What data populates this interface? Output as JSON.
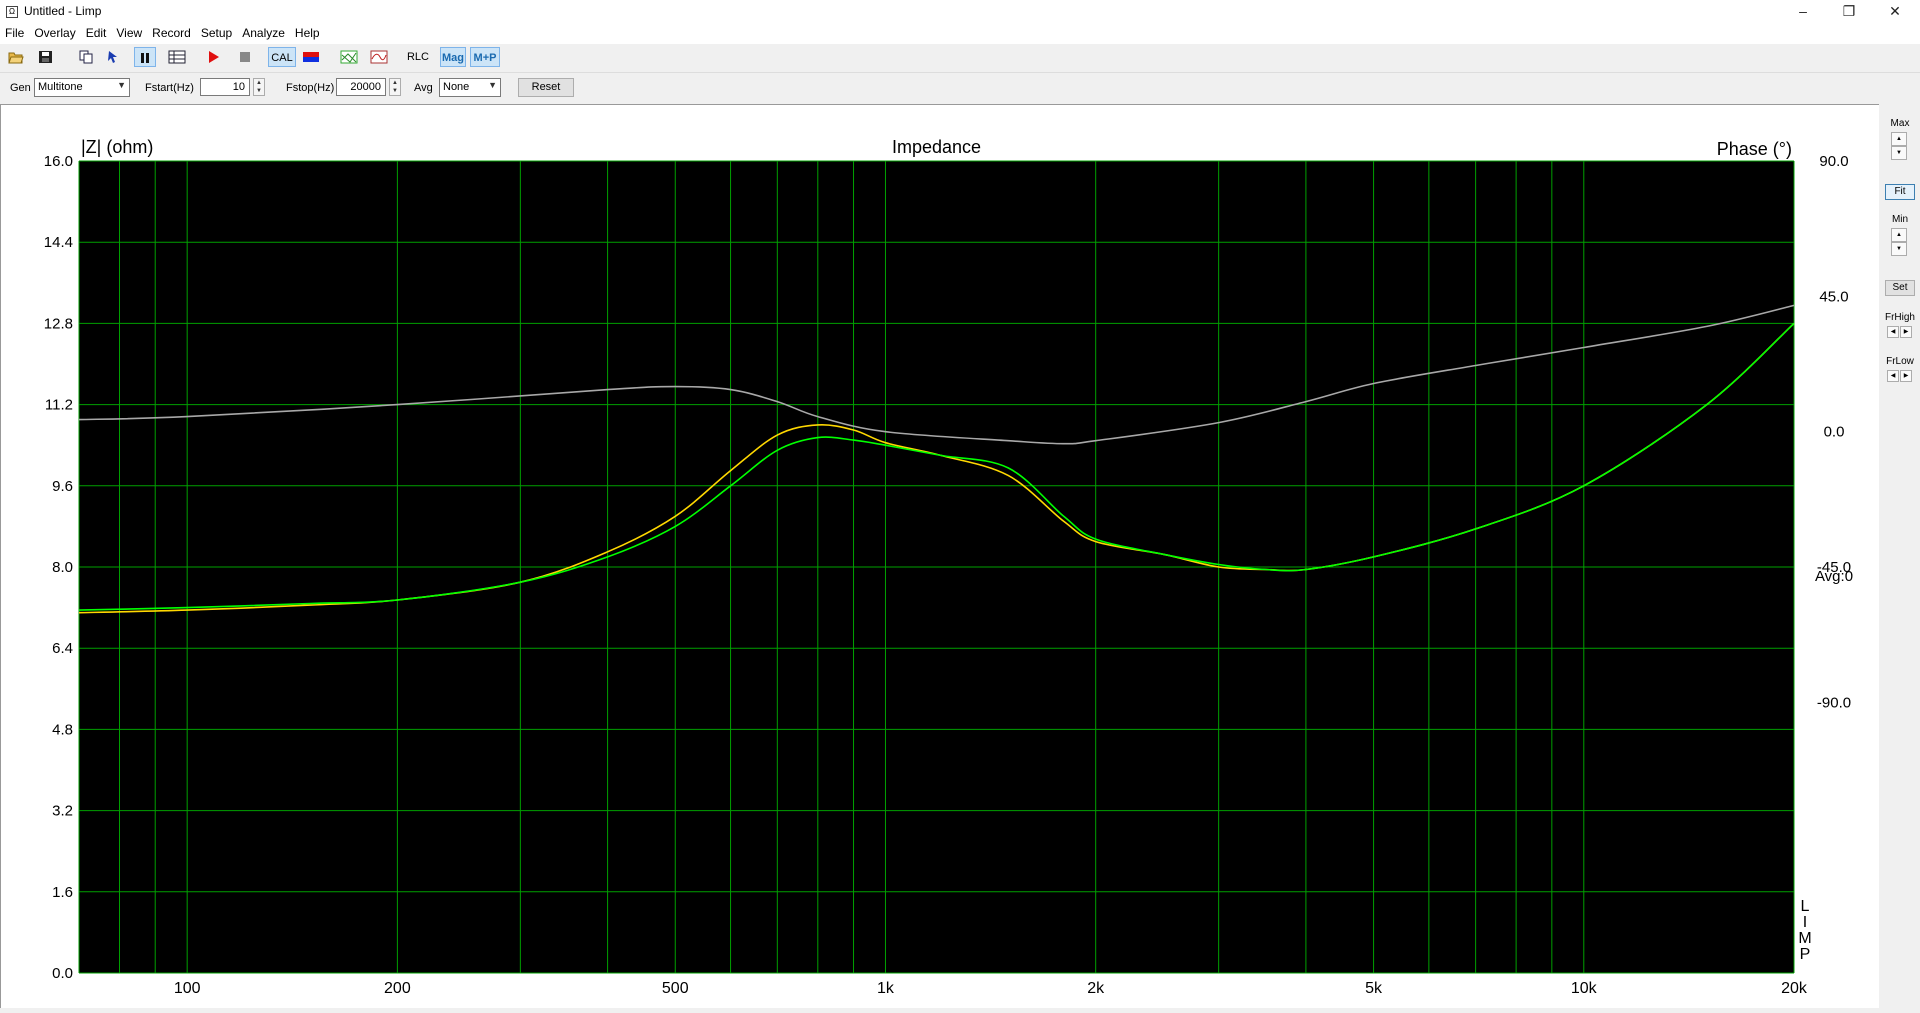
{
  "window": {
    "title": "Untitled - Limp",
    "minimize": "–",
    "restore": "❐",
    "close": "✕"
  },
  "menu": [
    "File",
    "Overlay",
    "Edit",
    "View",
    "Record",
    "Setup",
    "Analyze",
    "Help"
  ],
  "toolbar": {
    "cal": "CAL",
    "rlc": "RLC",
    "mag": "Mag",
    "mp": "M+P"
  },
  "params": {
    "gen_label": "Gen",
    "gen_value": "Multitone",
    "fstart_label": "Fstart(Hz)",
    "fstart_value": "10",
    "fstop_label": "Fstop(Hz)",
    "fstop_value": "20000",
    "avg_label": "Avg",
    "avg_value": "None",
    "reset": "Reset"
  },
  "side": {
    "max": "Max",
    "fit": "Fit",
    "min": "Min",
    "set": "Set",
    "frhigh": "FrHigh",
    "frlow": "FrLow"
  },
  "colors": {
    "plot_bg": "#000000",
    "grid": "#00a000",
    "curve_measured": "#00ff00",
    "curve_overlay": "#ffd800",
    "phase": "#a8a8a8"
  },
  "chart_data": {
    "type": "line",
    "title": "Impedance",
    "ylabel": "|Z| (ohm)",
    "y2label": "Phase (°)",
    "x_scale": "log",
    "xlim": [
      70,
      20000
    ],
    "ylim": [
      0,
      16
    ],
    "y2lim": [
      -180,
      90
    ],
    "x_ticks": [
      {
        "v": 100,
        "label": "100"
      },
      {
        "v": 200,
        "label": "200"
      },
      {
        "v": 500,
        "label": "500"
      },
      {
        "v": 1000,
        "label": "1k"
      },
      {
        "v": 2000,
        "label": "2k"
      },
      {
        "v": 5000,
        "label": "5k"
      },
      {
        "v": 10000,
        "label": "10k"
      },
      {
        "v": 20000,
        "label": "20k"
      }
    ],
    "y_ticks": [
      "0.0",
      "1.6",
      "3.2",
      "4.8",
      "6.4",
      "8.0",
      "9.6",
      "11.2",
      "12.8",
      "14.4",
      "16.0"
    ],
    "y2_ticks": [
      {
        "v": 90,
        "label": "90.0"
      },
      {
        "v": 45,
        "label": "45.0"
      },
      {
        "v": 0,
        "label": "0.0"
      },
      {
        "v": -45,
        "label": "-45.0"
      },
      {
        "v": -90,
        "label": "-90.0"
      }
    ],
    "avg_label": "Avg:0",
    "vertical_label": [
      "L",
      "I",
      "M",
      "P"
    ],
    "series": [
      {
        "color": "#a8a8a8",
        "axis": "phase",
        "x": [
          70,
          100,
          200,
          400,
          500,
          600,
          700,
          800,
          1000,
          1500,
          1800,
          2000,
          3000,
          4000,
          5000,
          7000,
          10000,
          15000,
          20000
        ],
        "y": [
          4,
          5,
          9,
          14,
          15,
          14,
          10,
          5,
          0,
          -3,
          -4,
          -3,
          3,
          10,
          16,
          22,
          28,
          35,
          42
        ]
      },
      {
        "color": "#ffd800",
        "axis": "impedance",
        "x": [
          70,
          100,
          150,
          200,
          300,
          400,
          500,
          600,
          700,
          800,
          900,
          1000,
          1200,
          1500,
          1800,
          2000,
          2500,
          3000,
          3500,
          4000,
          5000,
          7000,
          10000,
          15000,
          20000
        ],
        "y": [
          7.1,
          7.15,
          7.25,
          7.35,
          7.7,
          8.3,
          9.0,
          9.9,
          10.6,
          10.8,
          10.7,
          10.45,
          10.2,
          9.8,
          8.9,
          8.5,
          8.25,
          8.0,
          7.95,
          7.95,
          8.2,
          8.75,
          9.6,
          11.2,
          12.8
        ]
      },
      {
        "color": "#00ff00",
        "axis": "impedance",
        "x": [
          70,
          100,
          150,
          200,
          300,
          400,
          500,
          600,
          700,
          800,
          900,
          1000,
          1200,
          1500,
          1800,
          2000,
          2500,
          3000,
          3500,
          4000,
          5000,
          7000,
          10000,
          15000,
          20000
        ],
        "y": [
          7.15,
          7.2,
          7.28,
          7.35,
          7.7,
          8.2,
          8.8,
          9.6,
          10.3,
          10.55,
          10.5,
          10.4,
          10.2,
          9.95,
          9.0,
          8.55,
          8.25,
          8.05,
          7.95,
          7.95,
          8.2,
          8.75,
          9.6,
          11.2,
          12.8
        ]
      }
    ]
  }
}
